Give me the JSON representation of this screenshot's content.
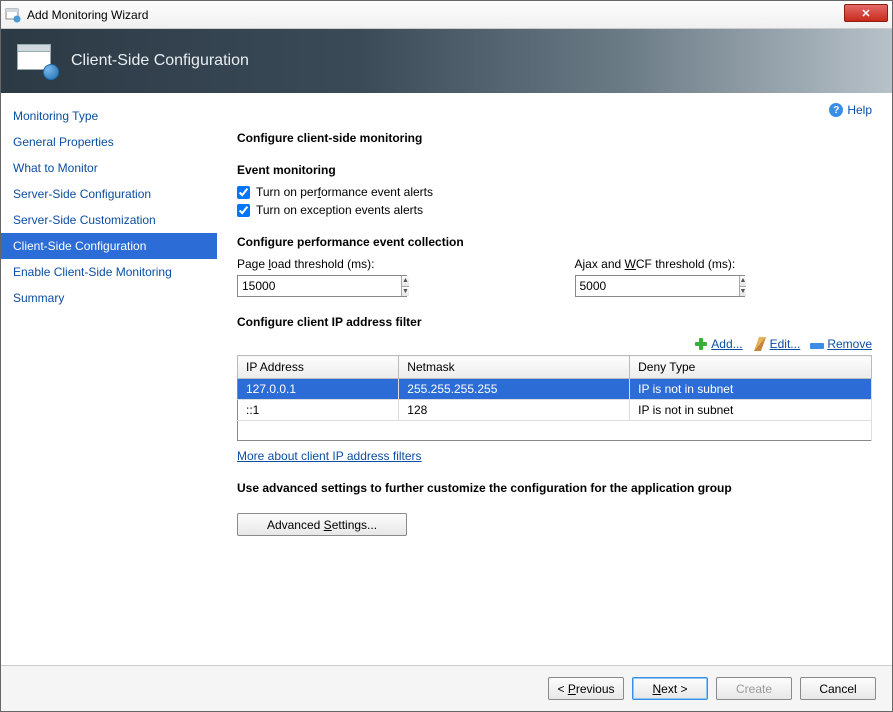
{
  "window": {
    "title": "Add Monitoring Wizard"
  },
  "banner": {
    "heading": "Client-Side Configuration"
  },
  "help_label": "Help",
  "sidebar": {
    "items": [
      {
        "label": "Monitoring Type",
        "selected": false
      },
      {
        "label": "General Properties",
        "selected": false
      },
      {
        "label": "What to Monitor",
        "selected": false
      },
      {
        "label": "Server-Side Configuration",
        "selected": false
      },
      {
        "label": "Server-Side Customization",
        "selected": false
      },
      {
        "label": "Client-Side Configuration",
        "selected": true
      },
      {
        "label": "Enable Client-Side Monitoring",
        "selected": false
      },
      {
        "label": "Summary",
        "selected": false
      }
    ]
  },
  "main": {
    "heading": "Configure client-side monitoring",
    "event_section": "Event monitoring",
    "perf_alerts_label_pre": "Turn on per",
    "perf_alerts_label_u": "f",
    "perf_alerts_label_post": "ormance event alerts",
    "perf_alerts_checked": true,
    "exc_alerts_label": "Turn on exception events alerts",
    "exc_alerts_checked": true,
    "perf_collection_section": "Configure performance event collection",
    "page_load_label_pre": "Page ",
    "page_load_label_u": "l",
    "page_load_label_post": "oad threshold (ms):",
    "page_load_value": "15000",
    "ajax_label_pre": "Ajax and ",
    "ajax_label_u": "W",
    "ajax_label_post": "CF threshold (ms):",
    "ajax_value": "5000",
    "ip_section": "Configure client IP address filter",
    "toolbar": {
      "add": "Add...",
      "edit": "Edit...",
      "remove": "Remove"
    },
    "table": {
      "columns": [
        "IP Address",
        "Netmask",
        "Deny Type"
      ],
      "rows": [
        {
          "ip": "127.0.0.1",
          "netmask": "255.255.255.255",
          "deny": "IP is not in subnet",
          "selected": true
        },
        {
          "ip": "::1",
          "netmask": "128",
          "deny": "IP is not in subnet",
          "selected": false
        }
      ]
    },
    "more_link": "More about client IP address filters",
    "advanced_heading": "Use advanced settings to further customize the configuration for the application group",
    "advanced_btn_pre": "Advanced ",
    "advanced_btn_u": "S",
    "advanced_btn_post": "ettings..."
  },
  "footer": {
    "previous_pre": "< ",
    "previous_u": "P",
    "previous_post": "revious",
    "next_u": "N",
    "next_post": "ext >",
    "create": "Create",
    "cancel": "Cancel"
  }
}
